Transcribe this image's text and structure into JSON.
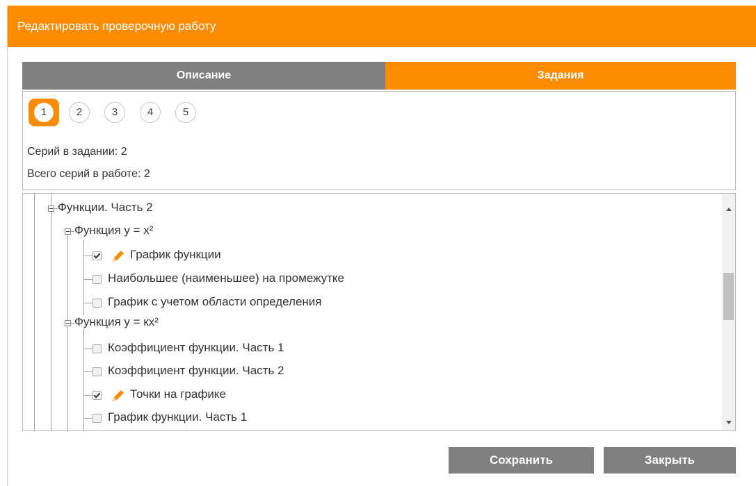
{
  "dialog": {
    "title": "Редактировать проверочную работу"
  },
  "tabs": [
    {
      "label": "Описание",
      "active": false
    },
    {
      "label": "Задания",
      "active": true
    }
  ],
  "task_numbers": [
    "1",
    "2",
    "3",
    "4",
    "5"
  ],
  "selected_task": "1",
  "info": {
    "series_in_task": "Серий в задании: 2",
    "total_series": "Всего серий в работе: 2"
  },
  "tree": {
    "root": "Функции. Часть 2",
    "group1": {
      "label": "Функция y = x²",
      "items": [
        {
          "label": "График функции",
          "checked": true,
          "edit_icon": "pencil-icon"
        },
        {
          "label": "Наибольшее (наименьшее) на промежутке",
          "checked": false
        },
        {
          "label": "График с учетом области определения",
          "checked": false
        }
      ]
    },
    "group2": {
      "label": "Функция y = кx²",
      "items": [
        {
          "label": "Коэффициент функции. Часть 1",
          "checked": false
        },
        {
          "label": "Коэффициент функции. Часть 2",
          "checked": false
        },
        {
          "label": "Точки на графике",
          "checked": true,
          "edit_icon": "pencil-icon"
        },
        {
          "label": "График функции. Часть 1",
          "checked": false
        }
      ]
    }
  },
  "buttons": {
    "save": "Сохранить",
    "close": "Закрыть"
  },
  "colors": {
    "accent": "#ff8c00",
    "inactive": "#808080"
  }
}
